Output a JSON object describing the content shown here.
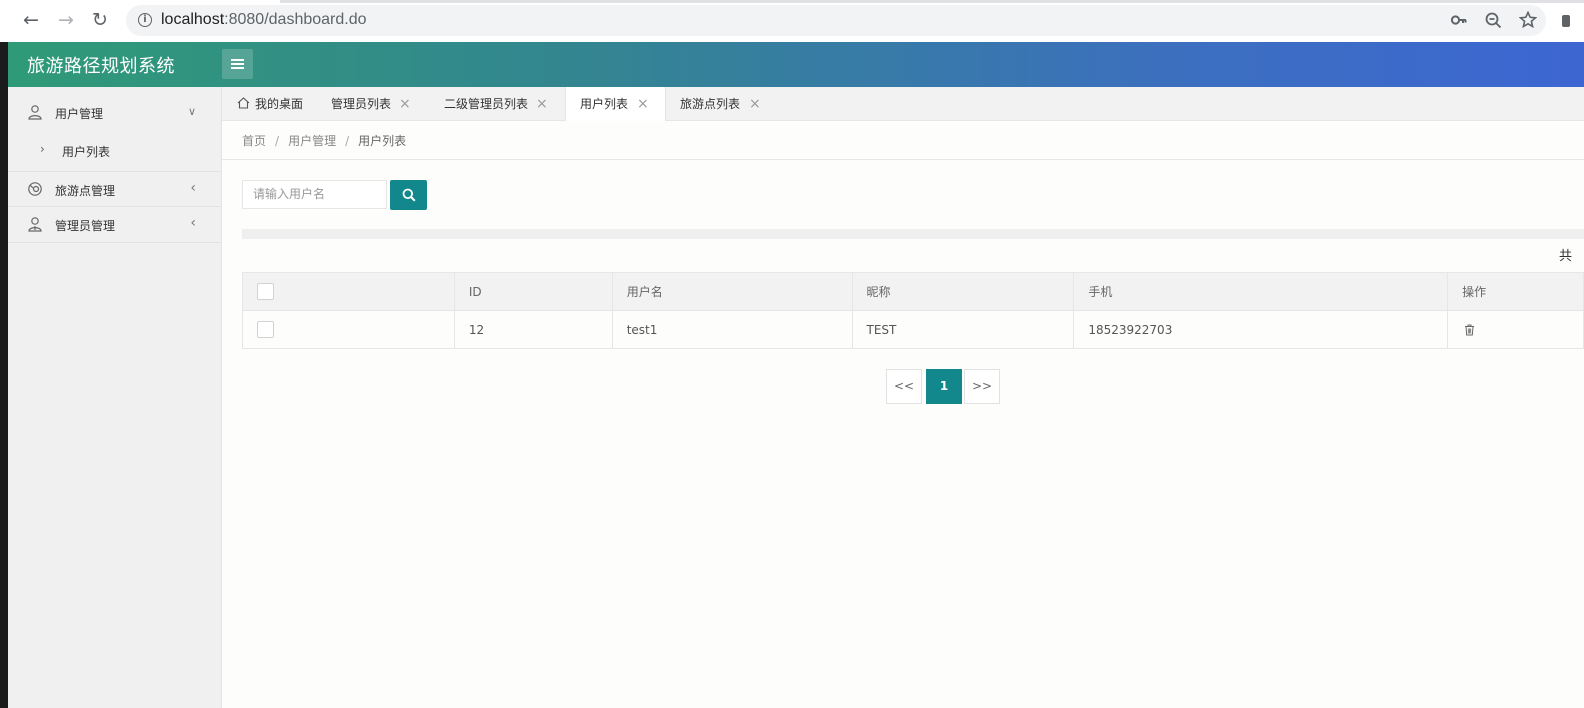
{
  "browser": {
    "url_host": "localhost",
    "url_rest": ":8080/dashboard.do"
  },
  "app": {
    "title": "旅游路径规划系统"
  },
  "sidebar": {
    "items": [
      {
        "label": "用户管理",
        "icon": "user-icon",
        "state": "expanded"
      },
      {
        "label": "旅游点管理",
        "icon": "map-pin-icon",
        "state": "collapsed"
      },
      {
        "label": "管理员管理",
        "icon": "admin-icon",
        "state": "collapsed"
      }
    ],
    "sub_items": [
      {
        "label": "用户列表"
      }
    ]
  },
  "tabs": [
    {
      "label": "我的桌面",
      "closable": false,
      "active": false
    },
    {
      "label": "管理员列表",
      "closable": true,
      "active": false
    },
    {
      "label": "二级管理员列表",
      "closable": true,
      "active": false
    },
    {
      "label": "用户列表",
      "closable": true,
      "active": true
    },
    {
      "label": "旅游点列表",
      "closable": true,
      "active": false
    }
  ],
  "breadcrumb": [
    "首页",
    "用户管理",
    "用户列表"
  ],
  "search": {
    "placeholder": "请输入用户名",
    "value": ""
  },
  "total_text": "共",
  "table": {
    "columns": [
      "",
      "ID",
      "用户名",
      "昵称",
      "手机",
      "操作"
    ],
    "rows": [
      {
        "id": "12",
        "username": "test1",
        "nickname": "TEST",
        "phone": "18523922703"
      }
    ]
  },
  "pagination": {
    "prev": "<<",
    "current": "1",
    "next": ">>"
  },
  "colors": {
    "accent": "#12888c",
    "header_start": "#2f9a77",
    "header_end": "#3d66d2"
  }
}
